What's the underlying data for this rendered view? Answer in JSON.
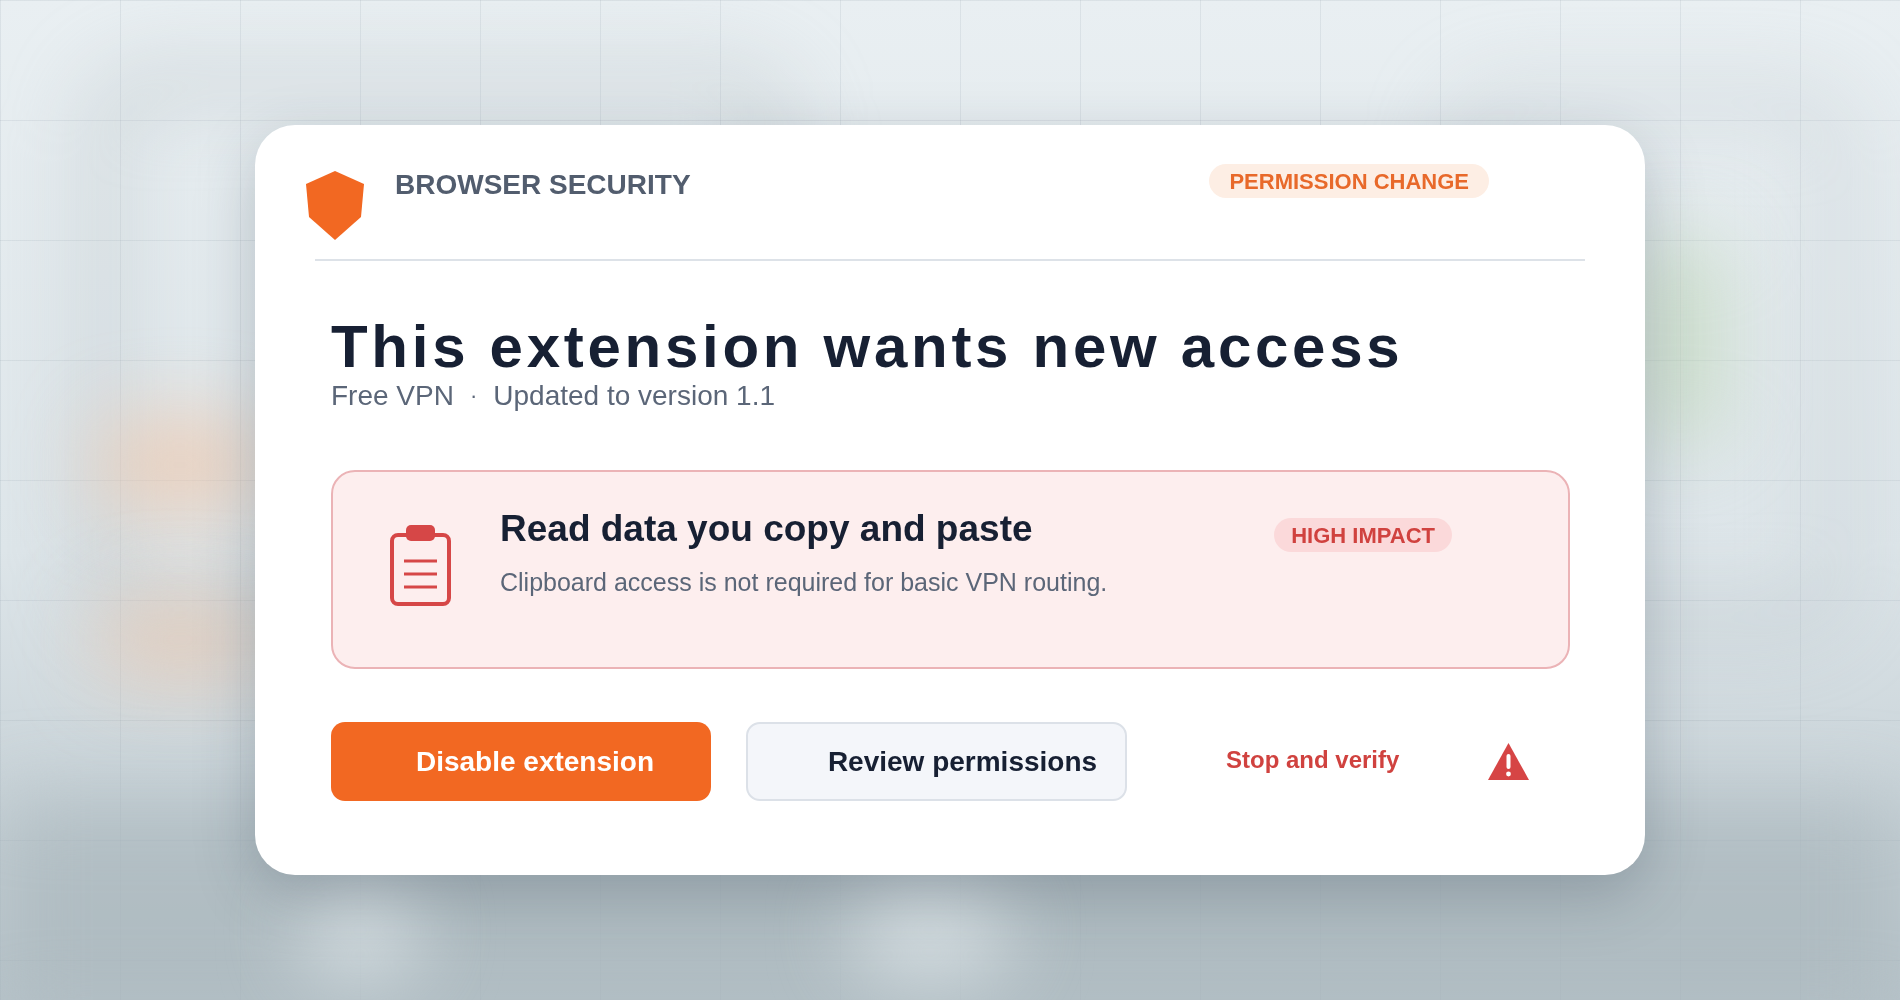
{
  "header": {
    "product": "BROWSER SECURITY",
    "badge": "PERMISSION CHANGE"
  },
  "title": "This extension wants new access",
  "subtitle": {
    "extension": "Free VPN",
    "separator": "·",
    "update": "Updated to version 1.1"
  },
  "permission": {
    "title": "Read data you copy and paste",
    "description": "Clipboard access is not required for basic VPN routing.",
    "impact": "HIGH IMPACT"
  },
  "actions": [
    {
      "kind": "primary",
      "label": "Disable extension"
    },
    {
      "kind": "secondary",
      "label": "Review permissions"
    },
    {
      "kind": "link",
      "label": "Stop and verify"
    }
  ]
}
